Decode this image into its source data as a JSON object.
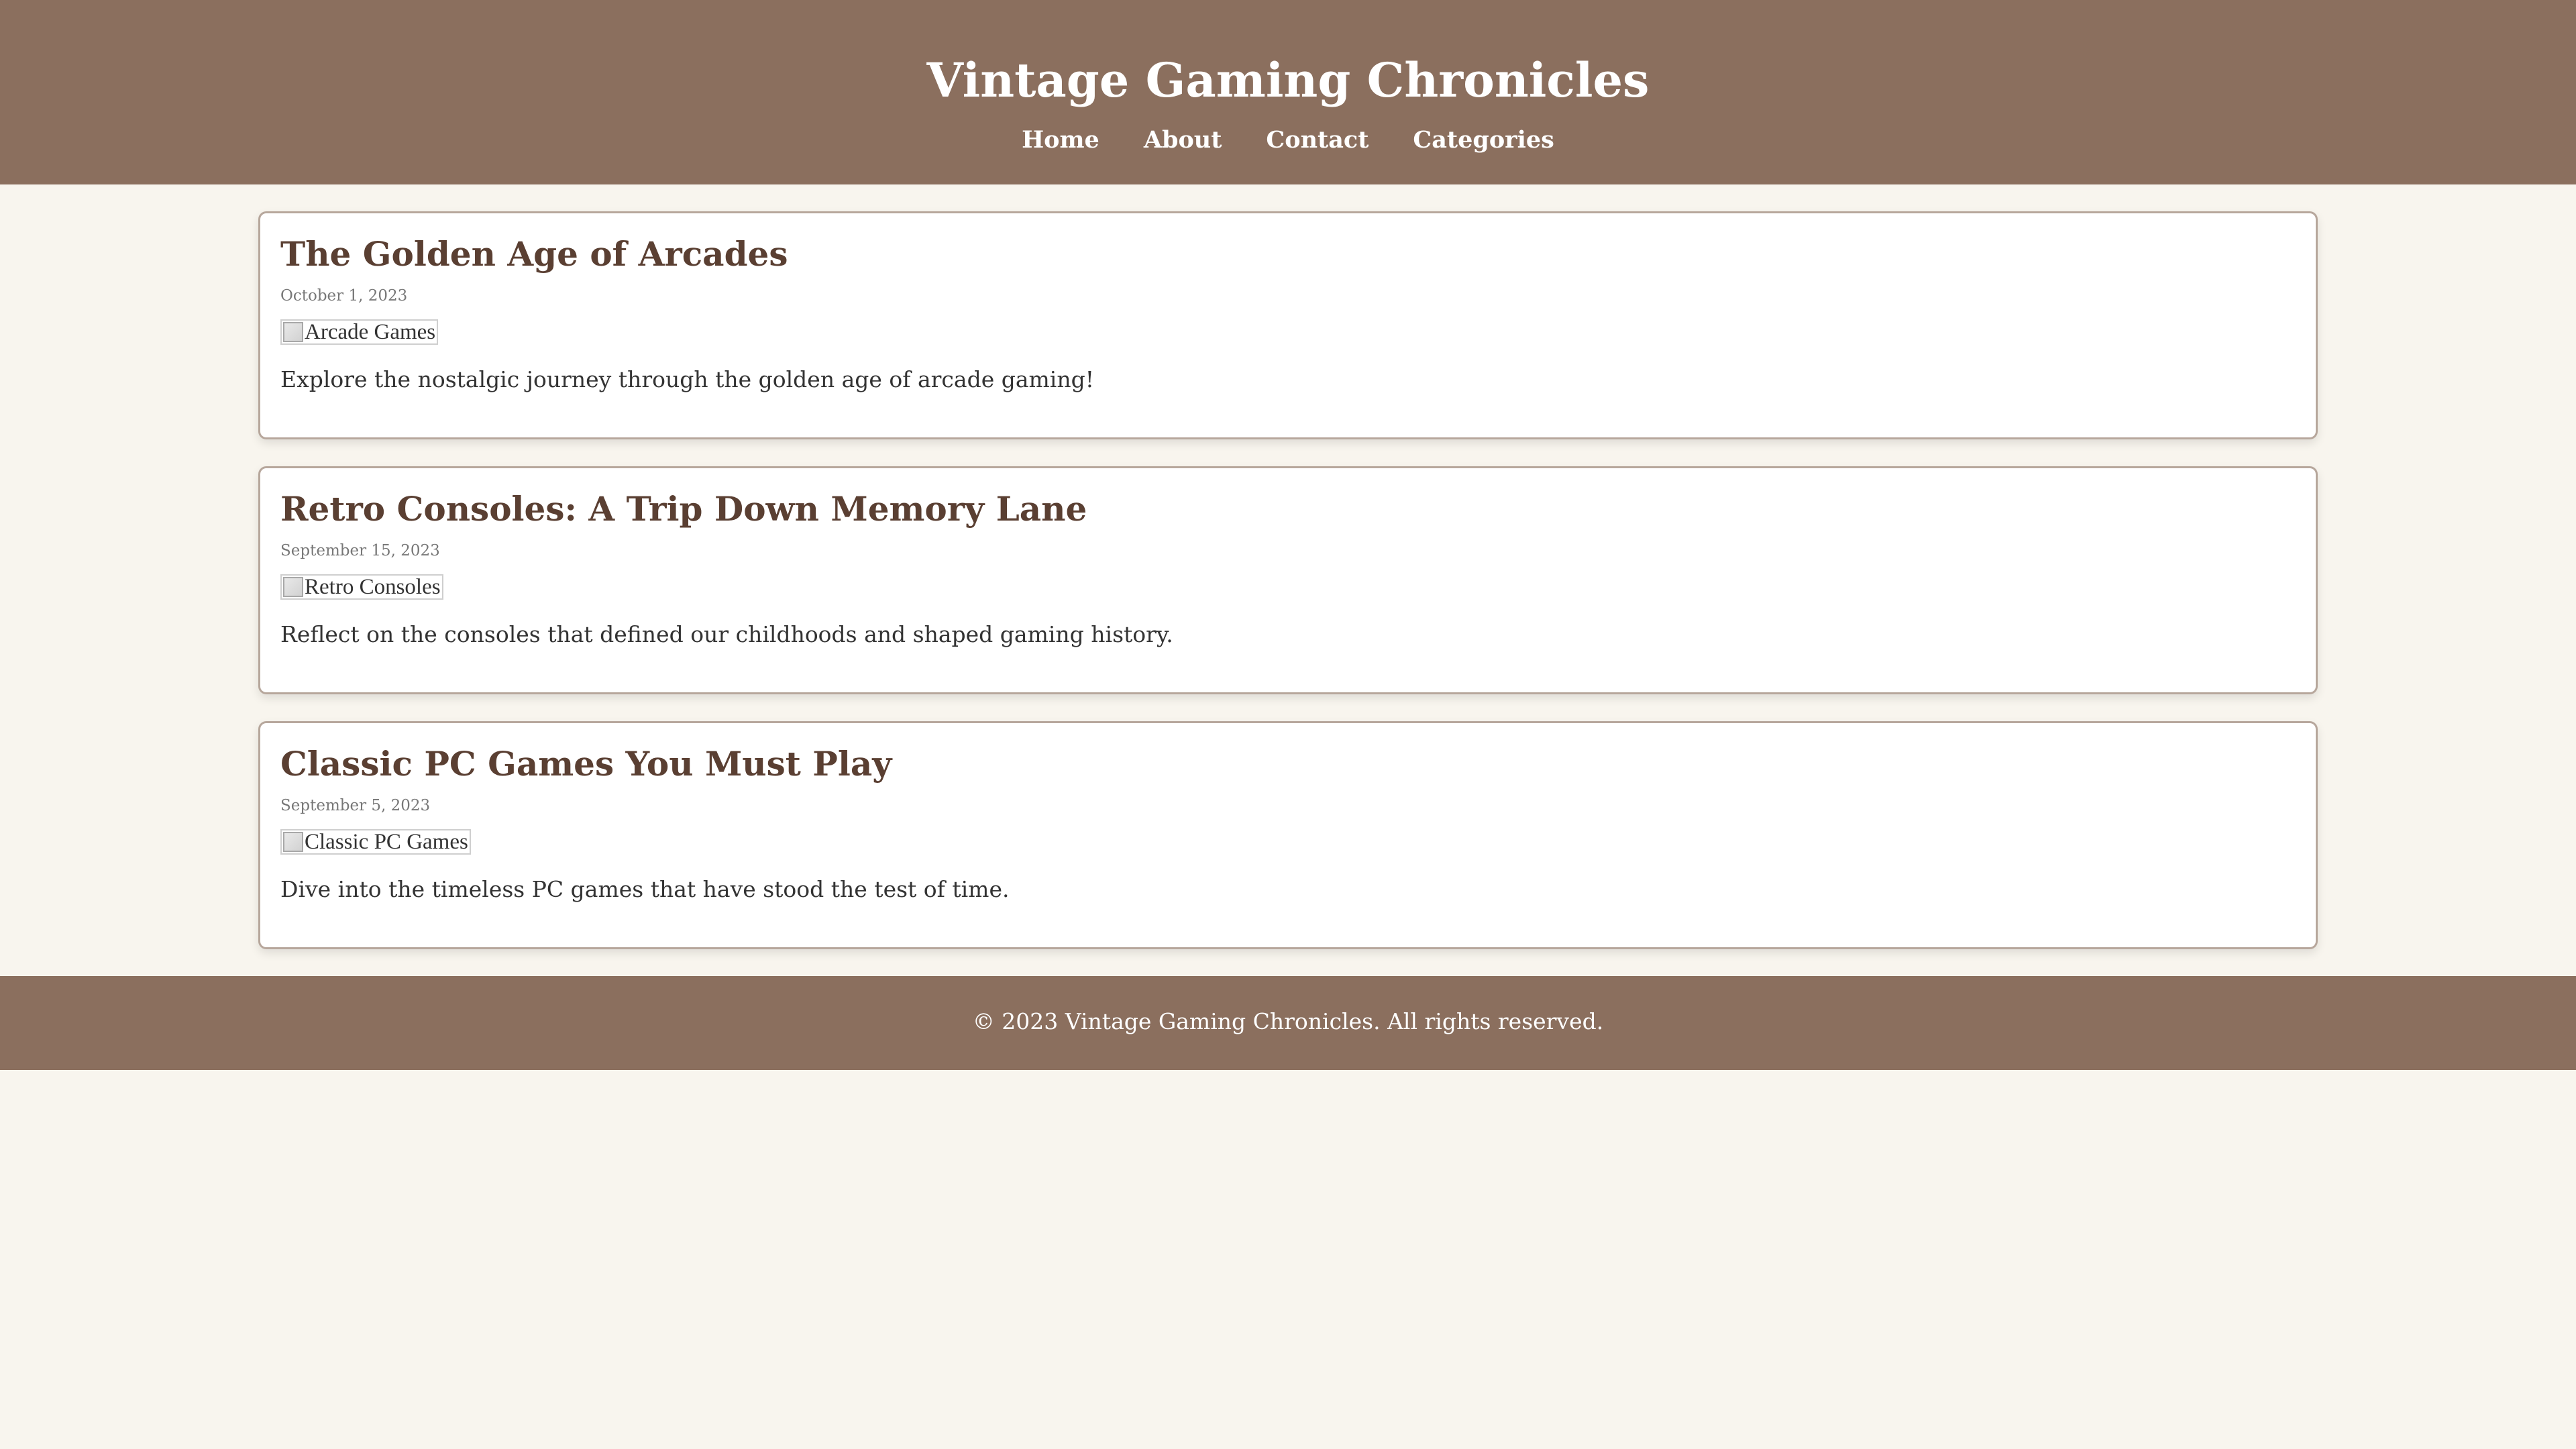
{
  "header": {
    "title": "Vintage Gaming Chronicles",
    "nav": [
      {
        "label": "Home"
      },
      {
        "label": "About"
      },
      {
        "label": "Contact"
      },
      {
        "label": "Categories"
      }
    ]
  },
  "posts": [
    {
      "title": "The Golden Age of Arcades",
      "date": "October 1, 2023",
      "image_alt": "Arcade Games",
      "excerpt": "Explore the nostalgic journey through the golden age of arcade gaming!"
    },
    {
      "title": "Retro Consoles: A Trip Down Memory Lane",
      "date": "September 15, 2023",
      "image_alt": "Retro Consoles",
      "excerpt": "Reflect on the consoles that defined our childhoods and shaped gaming history."
    },
    {
      "title": "Classic PC Games You Must Play",
      "date": "September 5, 2023",
      "image_alt": "Classic PC Games",
      "excerpt": "Dive into the timeless PC games that have stood the test of time."
    }
  ],
  "footer": {
    "text": "© 2023 Vintage Gaming Chronicles. All rights reserved."
  },
  "colors": {
    "header_bg": "#8b6f5e",
    "page_bg": "#f8f5ee",
    "title_text": "#5a3f32"
  }
}
